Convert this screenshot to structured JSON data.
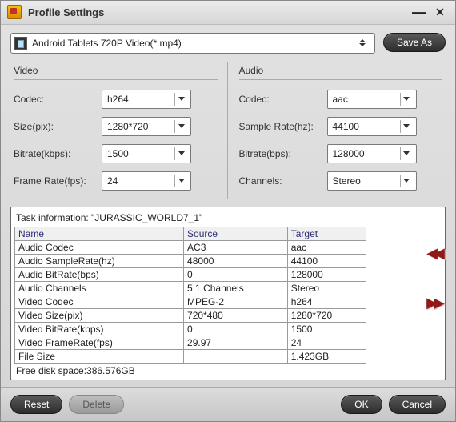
{
  "window": {
    "title": "Profile Settings"
  },
  "profile": {
    "selected": "Android Tablets 720P Video(*.mp4)",
    "save_as_label": "Save As"
  },
  "video": {
    "heading": "Video",
    "codec_label": "Codec:",
    "codec_value": "h264",
    "size_label": "Size(pix):",
    "size_value": "1280*720",
    "bitrate_label": "Bitrate(kbps):",
    "bitrate_value": "1500",
    "framerate_label": "Frame Rate(fps):",
    "framerate_value": "24"
  },
  "audio": {
    "heading": "Audio",
    "codec_label": "Codec:",
    "codec_value": "aac",
    "samplerate_label": "Sample Rate(hz):",
    "samplerate_value": "44100",
    "bitrate_label": "Bitrate(bps):",
    "bitrate_value": "128000",
    "channels_label": "Channels:",
    "channels_value": "Stereo"
  },
  "task": {
    "title": "Task information: \"JURASSIC_WORLD7_1\"",
    "headers": {
      "name": "Name",
      "source": "Source",
      "target": "Target"
    },
    "rows": [
      {
        "name": "Audio Codec",
        "source": "AC3",
        "target": "aac"
      },
      {
        "name": "Audio SampleRate(hz)",
        "source": "48000",
        "target": "44100"
      },
      {
        "name": "Audio BitRate(bps)",
        "source": "0",
        "target": "128000"
      },
      {
        "name": "Audio Channels",
        "source": "5.1 Channels",
        "target": "Stereo"
      },
      {
        "name": "Video Codec",
        "source": "MPEG-2",
        "target": "h264"
      },
      {
        "name": "Video Size(pix)",
        "source": "720*480",
        "target": "1280*720"
      },
      {
        "name": "Video BitRate(kbps)",
        "source": "0",
        "target": "1500"
      },
      {
        "name": "Video FrameRate(fps)",
        "source": "29.97",
        "target": "24"
      },
      {
        "name": "File Size",
        "source": "",
        "target": "1.423GB"
      }
    ],
    "free_disk": "Free disk space:386.576GB"
  },
  "footer": {
    "reset_label": "Reset",
    "delete_label": "Delete",
    "ok_label": "OK",
    "cancel_label": "Cancel"
  }
}
